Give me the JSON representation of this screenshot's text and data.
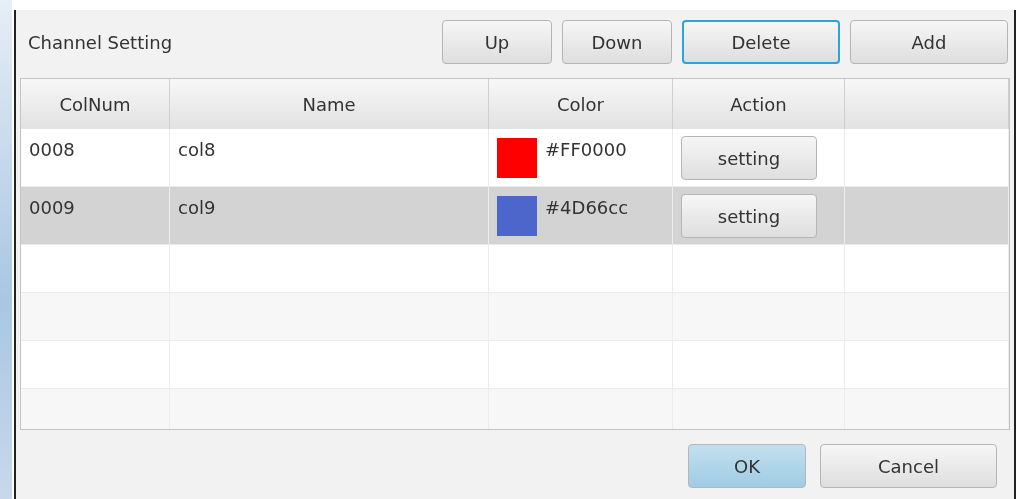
{
  "dialog": {
    "title": "Channel Setting",
    "toolbar_buttons": [
      {
        "label": "Up",
        "focused": false
      },
      {
        "label": "Down",
        "focused": false
      },
      {
        "label": "Delete",
        "focused": true
      },
      {
        "label": "Add",
        "focused": false
      }
    ],
    "table": {
      "columns": [
        "ColNum",
        "Name",
        "Color",
        "Action"
      ],
      "rows": [
        {
          "colnum": "0008",
          "name": "col8",
          "color": "#ff0000",
          "color_text": "#FF0000",
          "action": "setting",
          "selected": false
        },
        {
          "colnum": "0009",
          "name": "col9",
          "color": "#4d66cc",
          "color_text": "#4D66cc",
          "action": "setting",
          "selected": true
        }
      ]
    },
    "footer_buttons": [
      {
        "label": "OK",
        "default": true
      },
      {
        "label": "Cancel",
        "default": false
      }
    ]
  }
}
